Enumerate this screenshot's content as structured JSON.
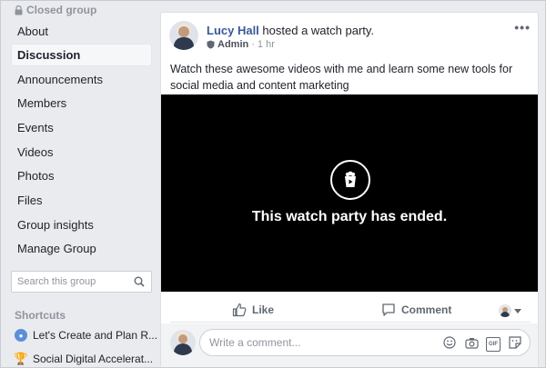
{
  "sidebar": {
    "group_type": "Closed group",
    "items": [
      {
        "label": "About"
      },
      {
        "label": "Discussion"
      },
      {
        "label": "Announcements"
      },
      {
        "label": "Members"
      },
      {
        "label": "Events"
      },
      {
        "label": "Videos"
      },
      {
        "label": "Photos"
      },
      {
        "label": "Files"
      },
      {
        "label": "Group insights"
      },
      {
        "label": "Manage Group"
      }
    ],
    "active_item": "Discussion",
    "search_placeholder": "Search this group",
    "shortcuts_title": "Shortcuts",
    "shortcuts": [
      {
        "label": "Let's Create and Plan R...",
        "icon": "group-icon"
      },
      {
        "label": "Social Digital Accelerat...",
        "icon": "trophy-icon"
      }
    ]
  },
  "post": {
    "author": "Lucy Hall",
    "action": "hosted a watch party.",
    "role": "Admin",
    "time": "1 hr",
    "text": "Watch these awesome videos with me and learn some new tools for social media and content marketing",
    "video_status": "This watch party has ended.",
    "like_label": "Like",
    "comment_label": "Comment",
    "comment_placeholder": "Write a comment..."
  },
  "colors": {
    "link": "#365899",
    "page_bg": "#e9ebee",
    "muted": "#90949c"
  }
}
